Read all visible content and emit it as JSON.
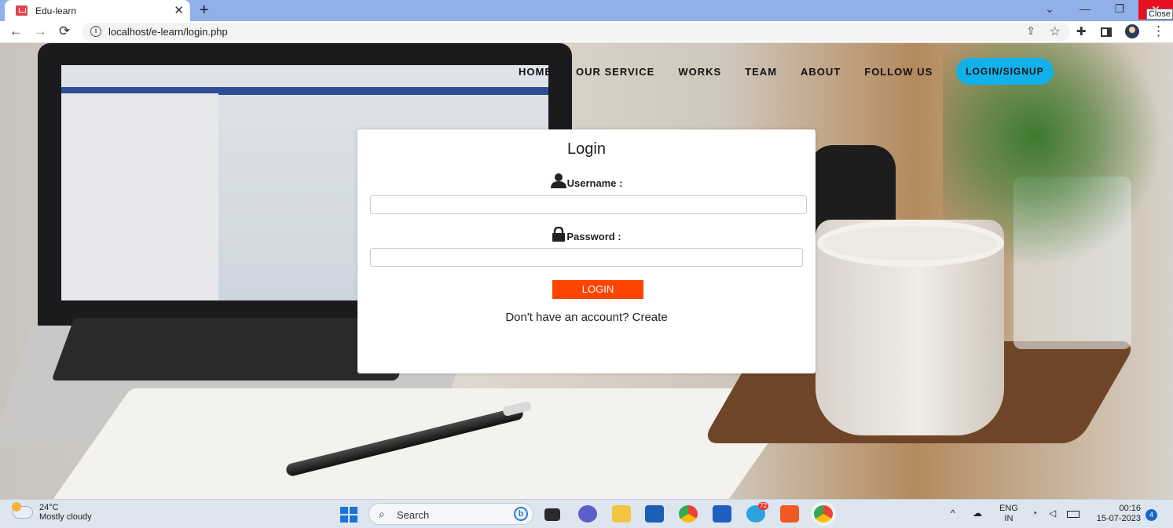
{
  "browser": {
    "tab_title": "Edu-learn",
    "tab_close": "✕",
    "new_tab": "+",
    "url": "localhost/e-learn/login.php",
    "close_tooltip": "Close",
    "buttons": {
      "back": "←",
      "forward": "→",
      "reload": "⟳",
      "minimize": "—",
      "restore": "❐",
      "dropdown": "⌄",
      "close": "✕",
      "share": "⇪",
      "star": "☆",
      "menu": "⋮"
    }
  },
  "site_nav": {
    "items": [
      "HOME",
      "OUR SERVICE",
      "WORKS",
      "TEAM",
      "ABOUT",
      "FOLLOW US"
    ],
    "cta": "LOGIN/SIGNUP"
  },
  "login": {
    "title": "Login",
    "username_label": "Username :",
    "password_label": "Password :",
    "username_value": "",
    "password_value": "",
    "submit_label": "LOGIN",
    "signup_prompt": "Don't have an account?",
    "signup_link": "Create"
  },
  "taskbar": {
    "weather_temp": "24°C",
    "weather_desc": "Mostly cloudy",
    "search_placeholder": "Search",
    "lang_top": "ENG",
    "lang_bottom": "IN",
    "time": "00:16",
    "date": "15-07-2023",
    "notification_count": "4",
    "telegram_badge": "72"
  },
  "colors": {
    "cta": "#12b1ea",
    "login_button": "#fe4402",
    "tabbar": "#8fb0e8",
    "close_red": "#e81123"
  }
}
